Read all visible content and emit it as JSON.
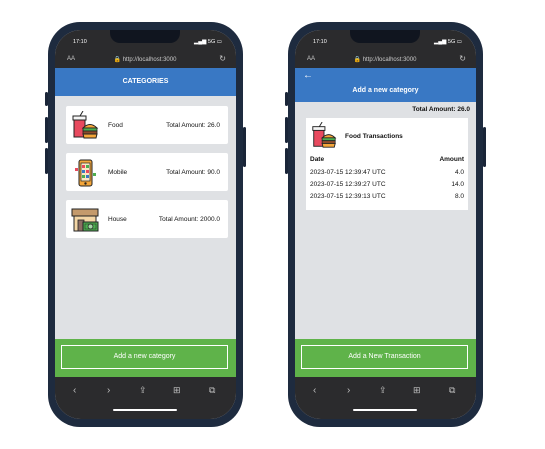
{
  "browser": {
    "time": "17:10",
    "signal": "5G",
    "aa": "AA",
    "url": "http://localhost:3000"
  },
  "categories_screen": {
    "title": "CATEGORIES",
    "items": [
      {
        "name": "Food",
        "amount": "Total Amount: 26.0",
        "icon": "food-icon"
      },
      {
        "name": "Mobile",
        "amount": "Total Amount: 90.0",
        "icon": "mobile-icon"
      },
      {
        "name": "House",
        "amount": "Total Amount: 2000.0",
        "icon": "house-icon"
      }
    ],
    "add_button": "Add a new category"
  },
  "transactions_screen": {
    "back": "←",
    "title": "Add a new category",
    "total": "Total Amount: 26.0",
    "card_title": "Food Transactions",
    "col_date": "Date",
    "col_amount": "Amount",
    "rows": [
      {
        "date": "2023-07-15 12:39:47 UTC",
        "amount": "4.0"
      },
      {
        "date": "2023-07-15 12:39:27 UTC",
        "amount": "14.0"
      },
      {
        "date": "2023-07-15 12:39:13 UTC",
        "amount": "8.0"
      }
    ],
    "add_button": "Add a New Transaction"
  },
  "colors": {
    "appbar": "#3978c4",
    "green": "#5fb34a",
    "phone_frame": "#1e2b3f"
  }
}
